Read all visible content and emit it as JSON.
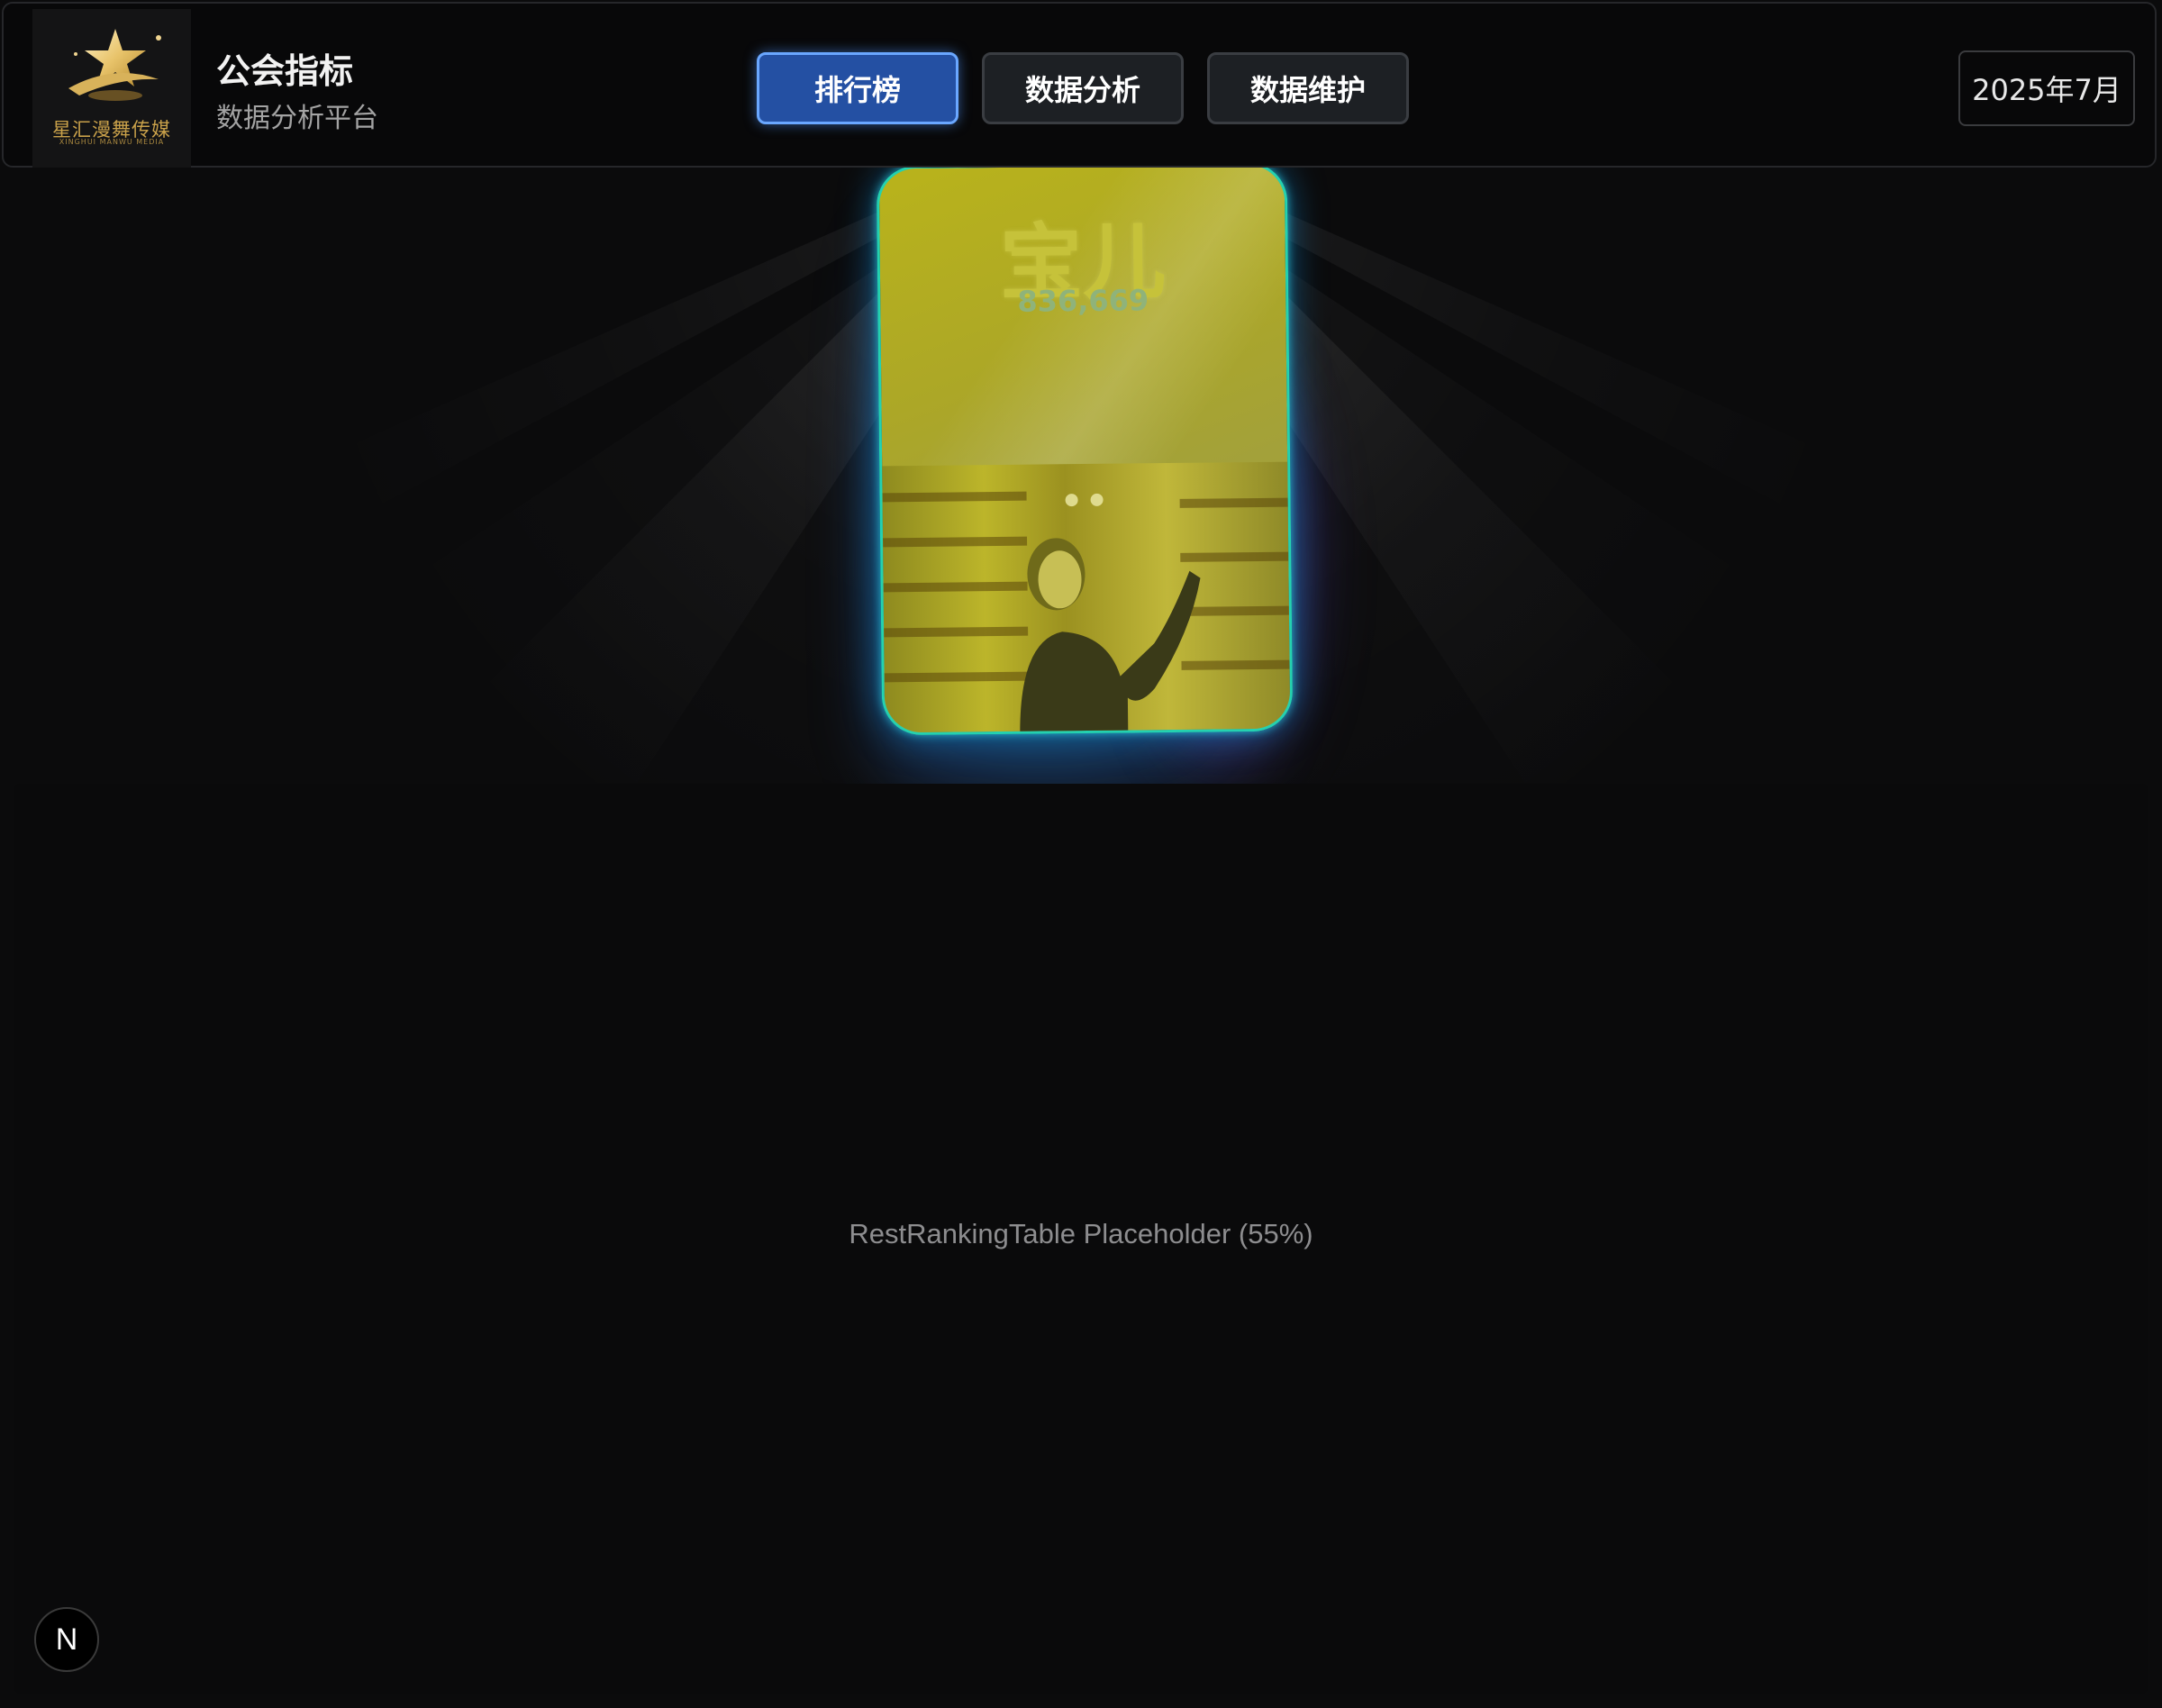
{
  "header": {
    "logo": {
      "text": "星汇漫舞传媒",
      "subtext": "XINGHUI MANWU MEDIA"
    },
    "title": "公会指标",
    "subtitle": "数据分析平台",
    "nav": [
      {
        "label": "排行榜",
        "active": true
      },
      {
        "label": "数据分析",
        "active": false
      },
      {
        "label": "数据维护",
        "active": false
      }
    ],
    "date": "2025年7月"
  },
  "top_card": {
    "name": "宝儿",
    "score": "836,669"
  },
  "rest_table": {
    "placeholder": "RestRankingTable Placeholder (55%)"
  },
  "dev_badge": {
    "label": "N"
  },
  "colors": {
    "background": "#0b0b0c",
    "nav_active": "#2450a3",
    "nav_active_border": "#6aa7ff",
    "card_fill": "#b0ab24",
    "card_border": "#24d1b0",
    "card_glow": "#14aae6"
  }
}
